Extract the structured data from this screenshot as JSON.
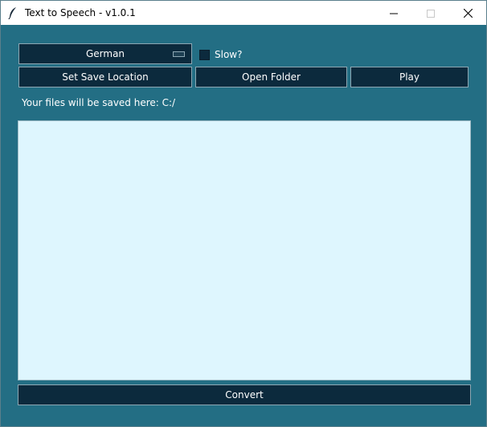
{
  "window": {
    "title": "Text to Speech - v1.0.1"
  },
  "controls": {
    "language_selected": "German",
    "slow_label": "Slow?",
    "slow_checked": false,
    "set_save_location_label": "Set Save Location",
    "open_folder_label": "Open Folder",
    "play_label": "Play",
    "save_path_text": "Your files will be saved here: C:/",
    "text_input_value": "",
    "convert_label": "Convert"
  },
  "icons": {
    "app": "feather-quill-icon",
    "minimize": "minimize-icon",
    "maximize": "maximize-icon",
    "close": "close-icon"
  },
  "colors": {
    "background": "#236e84",
    "button": "#0c2a3d",
    "text_area": "#def6fe"
  }
}
